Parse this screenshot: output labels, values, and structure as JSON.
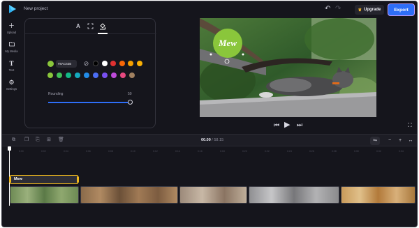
{
  "header": {
    "project_title": "New project",
    "upgrade_label": "Upgrade",
    "export_label": "Export"
  },
  "sidebar": {
    "items": [
      {
        "label": "Upload",
        "icon": "plus-icon"
      },
      {
        "label": "My Media",
        "icon": "folder-icon"
      },
      {
        "label": "Text",
        "icon": "text-icon"
      },
      {
        "label": "Settings",
        "icon": "gear-icon"
      }
    ]
  },
  "panel": {
    "tabs": [
      {
        "label": "A",
        "icon": "font-icon"
      },
      {
        "label": "",
        "icon": "resize-icon"
      },
      {
        "label": "",
        "icon": "fill-bucket-icon",
        "active": true
      }
    ],
    "selected_color": "#8AC63B",
    "swatches_row1": [
      "#000000",
      "#ffffff",
      "#e03131",
      "#f76707",
      "#f59f00",
      "#fab005"
    ],
    "swatches_row2": [
      "#8ac63b",
      "#40c057",
      "#12b886",
      "#15aabf",
      "#228be6",
      "#4c6ef5",
      "#7950f2",
      "#be4bdb",
      "#e64980",
      "#a08060"
    ],
    "rounding_label": "Rounding",
    "rounding_value": "50"
  },
  "preview": {
    "overlay_text": "Mew",
    "overlay_color": "#8ac63b"
  },
  "timeline": {
    "current_time": "00.00",
    "separator": " / ",
    "duration": "58.15",
    "ruler_ticks": [
      "0:00",
      "0:02",
      "0:04",
      "0:06",
      "0:08",
      "0:10",
      "0:12",
      "0:14",
      "0:16",
      "0:18",
      "0:20",
      "0:22",
      "0:24",
      "0:26",
      "0:28",
      "0:30",
      "0:32",
      "0:34"
    ],
    "text_clip_label": "Mew"
  },
  "colors": {
    "accent": "#2e6ef7",
    "export_border": "#c39cf6",
    "text_clip_border": "#f0b81c",
    "background": "#15151c"
  }
}
